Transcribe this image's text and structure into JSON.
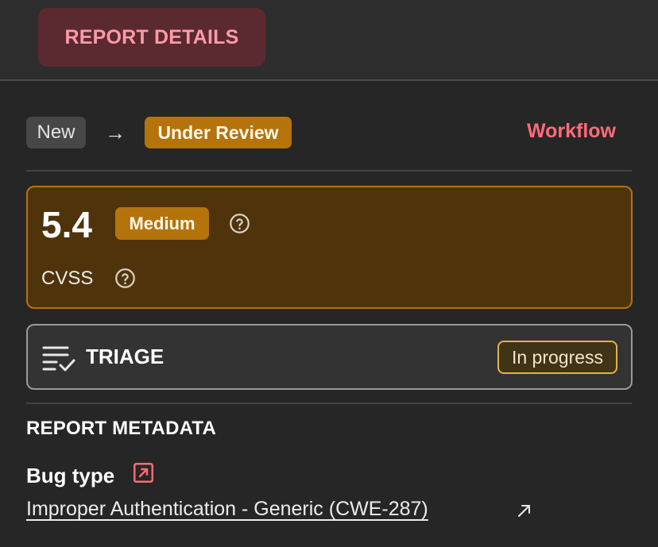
{
  "header": {
    "tab_label": "REPORT DETAILS"
  },
  "status": {
    "from_label": "New",
    "arrow": "→",
    "to_label": "Under Review",
    "workflow_link": "Workflow"
  },
  "cvss": {
    "score": "5.4",
    "severity": "Medium",
    "label": "CVSS",
    "icons": [
      "help-circle-icon"
    ]
  },
  "triage": {
    "title": "TRIAGE",
    "status": "In progress",
    "icon": "checklist-icon"
  },
  "metadata": {
    "heading": "REPORT METADATA",
    "bug_type_label": "Bug type",
    "bug_type_value": "Improper Authentication - Generic (CWE-287)",
    "icons": [
      "external-link-box-icon",
      "external-link-arrow-icon"
    ]
  },
  "colors": {
    "accent_red": "#ff6b78",
    "tab_bg": "#5a2a30",
    "tab_text": "#ff9aa6",
    "warning": "#b5730c",
    "cvss_bg": "#4f330b",
    "progress_border": "#e2b24a",
    "background": "#262626"
  }
}
